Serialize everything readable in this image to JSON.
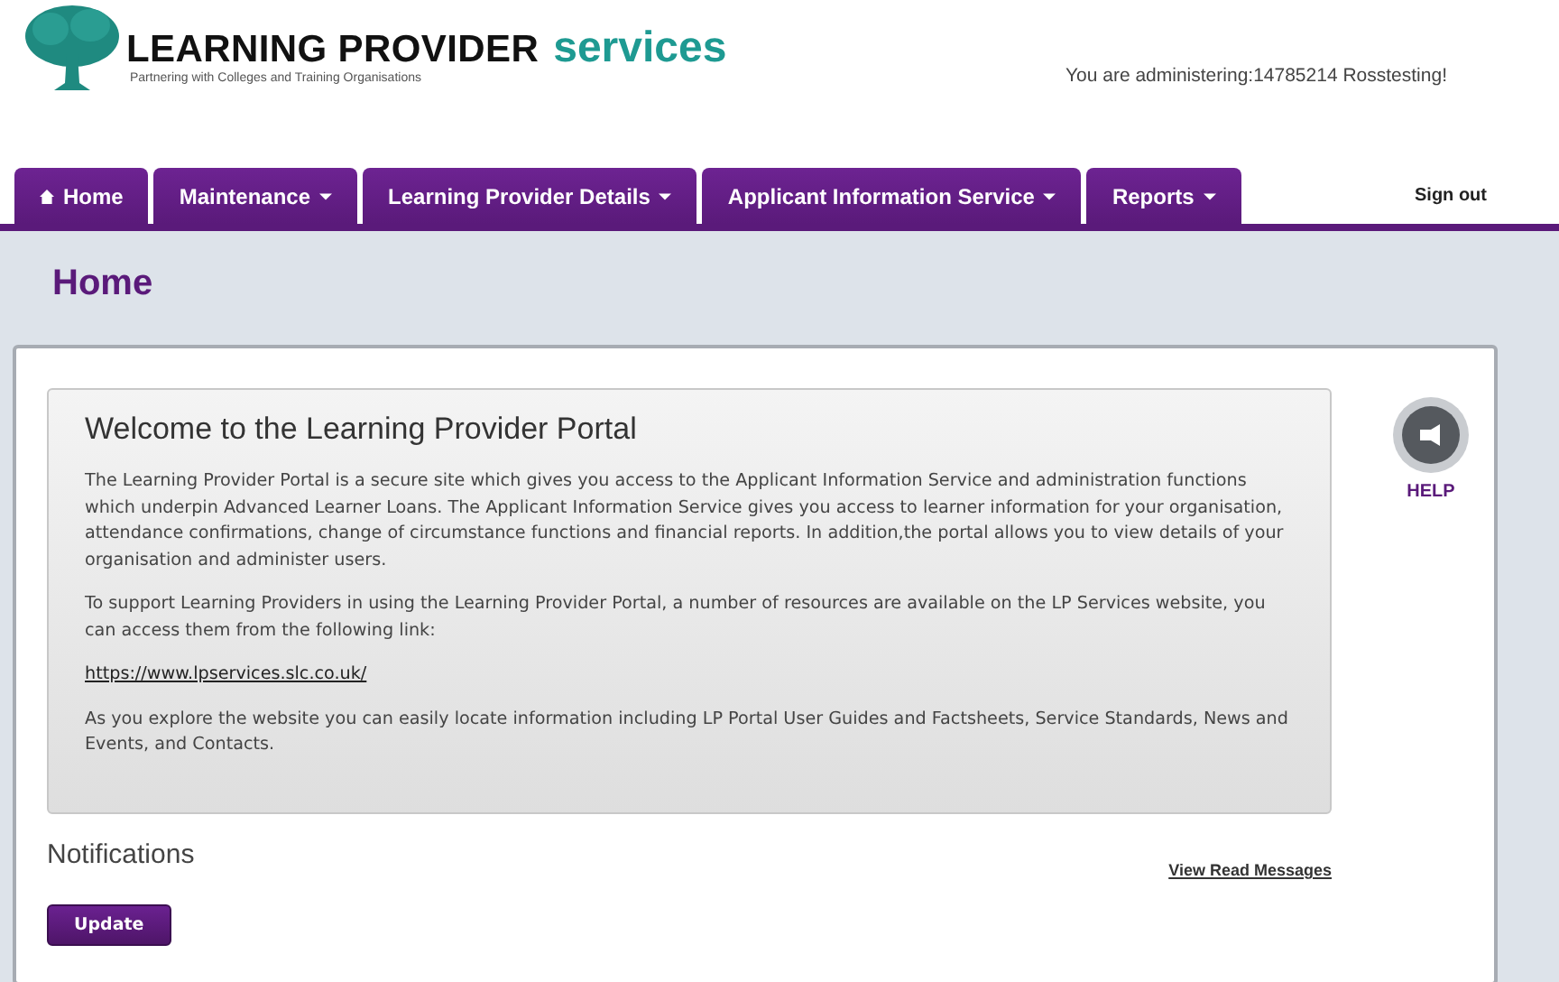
{
  "header": {
    "brand_main": "LEARNING PROVIDER",
    "brand_accent": "services",
    "tagline": "Partnering with Colleges and Training Organisations",
    "admin_notice": "You are administering:14785214 Rosstesting!"
  },
  "nav": {
    "tabs": [
      {
        "label": "Home",
        "kind": "home",
        "menu": false
      },
      {
        "label": "Maintenance",
        "menu": true
      },
      {
        "label": "Learning Provider Details",
        "menu": true
      },
      {
        "label": "Applicant Information Service",
        "menu": true
      },
      {
        "label": "Reports",
        "menu": true
      }
    ],
    "sign_out": "Sign out"
  },
  "page_title": "Home",
  "welcome": {
    "title": "Welcome to the Learning Provider Portal",
    "paragraphs": [
      "The Learning Provider Portal is a secure site which gives you access to the Applicant Information Service and administration functions which underpin Advanced Learner Loans. The Applicant Information Service gives you access to learner information for your organisation, attendance confirmations, change of circumstance functions and financial reports. In addition,the portal allows you to view details of your organisation and administer users.",
      "To support Learning Providers in using the Learning Provider Portal, a number of resources are available on the LP Services website, you can access them from the following link:"
    ],
    "link": "https://www.lpservices.slc.co.uk/",
    "closing": "As you explore the website you can easily locate information including LP Portal User Guides and Factsheets, Service Standards, News and Events, and Contacts."
  },
  "help": {
    "label": "HELP"
  },
  "notifications": {
    "title": "Notifications",
    "view_read": "View Read Messages",
    "button": "Update"
  }
}
